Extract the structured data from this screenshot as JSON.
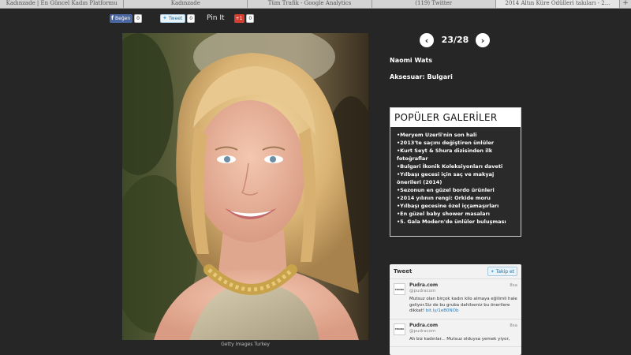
{
  "browser_tabs": [
    "Kadınzade | En Güncel Kadın Platformu",
    "Kadınzade",
    "Tüm Trafik - Google Analytics",
    "(119) Twitter",
    "2014 Altın Küre Ödülleri takıları - 2..."
  ],
  "tab_add": "+",
  "share": {
    "facebook_label": "Beğen",
    "facebook_count": "0",
    "tweet_label": "Tweet",
    "tweet_count": "0",
    "pinit_label": "Pin It",
    "gplus_label": "+1",
    "gplus_count": "0"
  },
  "gallery": {
    "prev_icon": "‹",
    "next_icon": "›",
    "counter": "23/28",
    "person": "Naomi Wats",
    "accessory": "Aksesuar: Bulgari",
    "photo_credit": "Getty Images Turkey"
  },
  "popular": {
    "title": "POPÜLER GALERİLER",
    "items": [
      "Meryem Uzerli'nin son hali",
      "2013'te saçını değiştiren ünlüler",
      "Kurt Seyt & Shura dizisinden ilk fotoğraflar",
      "Bulgari İkonik Koleksiyonları daveti",
      "Yılbaşı gecesi için saç ve makyaj önerileri (2014)",
      "Sezonun en güzel bordo ürünleri",
      "2014 yılının rengi: Orkide moru",
      "Yılbaşı gecesine özel iççamaşırları",
      "En güzel baby shower masaları",
      "5. Gala Modern'de ünlüler buluşması"
    ]
  },
  "twitter": {
    "title": "Tweet",
    "follow_label": "Takip et",
    "tweets": [
      {
        "avatar_text": "PUDRA",
        "name": "Pudra.com",
        "handle": "@pudracom",
        "time": "8sa",
        "text": "Mutsuz olan birçok kadın kilo almaya eğilimli hale geliyor.Siz de bu gruba dahilseniz bu önerilere dikkat!",
        "link": "bit.ly/1eB0NOb"
      },
      {
        "avatar_text": "PUDRA",
        "name": "Pudra.com",
        "handle": "@pudracom",
        "time": "8sa",
        "text": "Ah biz kadınlar... Mutsuz olduysa yemek yiyor,",
        "link": ""
      }
    ]
  },
  "colors": {
    "page_bg": "#262626",
    "facebook_blue": "#4a66a0",
    "gplus_red": "#d23f31",
    "twitter_link": "#2b7bb9"
  }
}
